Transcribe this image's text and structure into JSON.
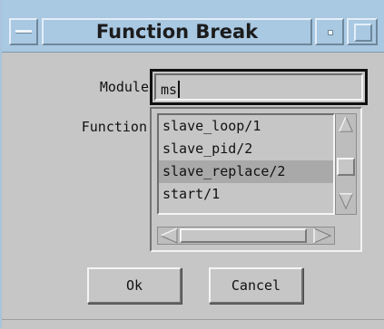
{
  "window": {
    "title": "Function Break"
  },
  "form": {
    "module_label": "Module",
    "module_value": "ms",
    "function_label": "Function"
  },
  "functions": {
    "items": [
      "slave_loop/1",
      "slave_pid/2",
      "slave_replace/2",
      "start/1"
    ],
    "selected": "slave_replace/2"
  },
  "buttons": {
    "ok_label": "Ok",
    "cancel_label": "Cancel"
  },
  "colors": {
    "titlebar": "#a9c8e2",
    "window_bg": "#c6c6c6",
    "selection": "#a9a9a9"
  }
}
